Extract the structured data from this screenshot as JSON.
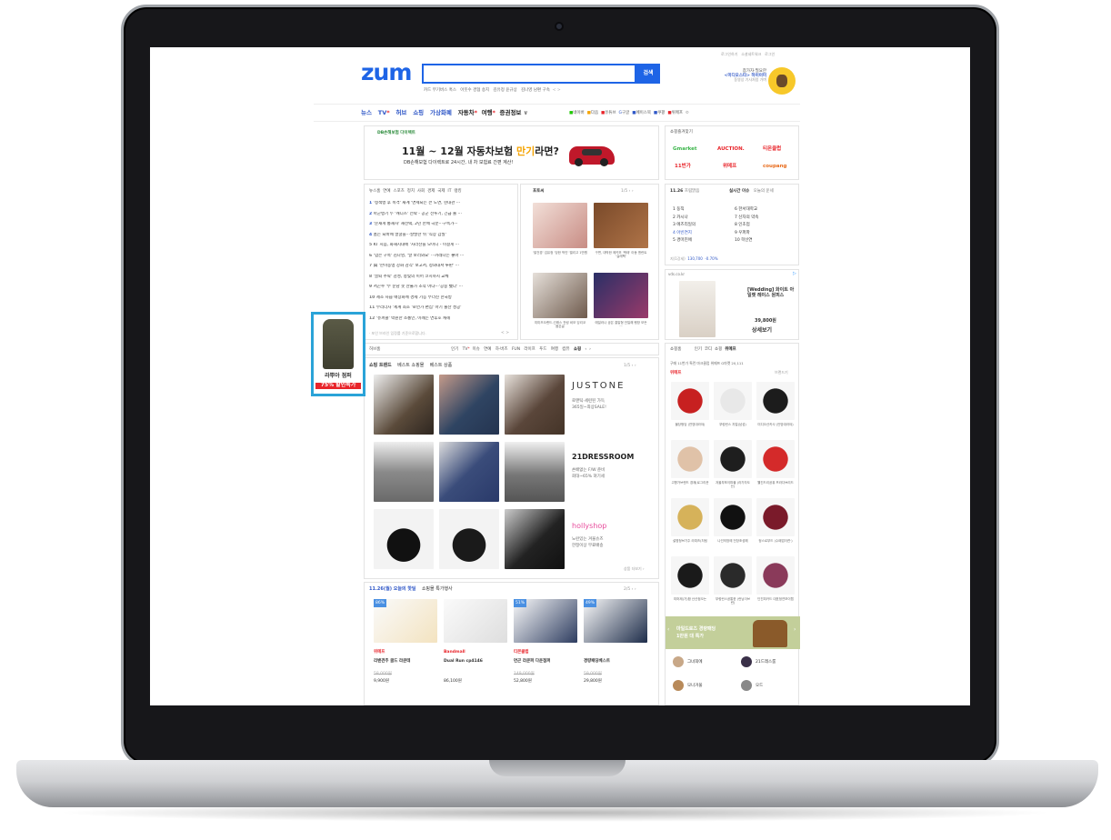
{
  "header": {
    "logo": "zum",
    "search_button": "검색",
    "search_value": "",
    "top_links": [
      "로그인하기",
      "소셜네트워크",
      "로그인"
    ],
    "suggest": [
      "카드 무기버스 혹스",
      "아웃수 경협 송지",
      "김유정 윤규상",
      "김나영 남편 구속"
    ],
    "suggest_nav": "< >",
    "profile_lines": [
      "참가자·필요한",
      "<미디오스타> 하이이미",
      "동영상 기사처럼 가벼"
    ]
  },
  "nav": {
    "items": [
      "뉴스",
      "TV",
      "허브",
      "쇼핑",
      "가상화폐",
      "자동차",
      "여행",
      "증권정보"
    ],
    "services": [
      "네이버",
      "다음",
      "유튜브",
      "구글",
      "페이스북",
      "쿠팡",
      "위메프"
    ]
  },
  "banner": {
    "brand": "DB손해보험 다이렉트",
    "title_pre": "11월 ~ 12월 자동차보험 ",
    "title_hl": "만기",
    "title_post": "라면?",
    "sub": "DB손해보험 다이렉트로 24시간, 내 차 보험료 간편 계산!"
  },
  "shortcuts": {
    "title": "쇼핑즐겨찾기",
    "items": [
      "Gmarket",
      "AUCTION.",
      "티몬클럽",
      "11번가",
      "위메프",
      "coupang"
    ]
  },
  "news": {
    "tabs": [
      "뉴스홈",
      "연예",
      "스포츠",
      "정치",
      "사회",
      "경제",
      "국제",
      "IT",
      "랭킹"
    ],
    "items": [
      "'정책병 후 폭격' 재계 '면세되는 큰 도면, 현대관 ···",
      "아군병기 두 '캐디즈' 전략 - 공군 전투기, 긴급 출 ···",
      "'문재게 통재자' 재선택, 2년 만에 극분···구속가···",
      "홈는 뇌바에 얼굴을···살발한 뒤 '직장 갑질'",
      "KT 지음, 화재시대에 '사라산을 모이니 - 이걸게 ···",
      "'넘은 구속' 김나영, '날 보러와요' ···카레나는 좋아 ···",
      "與 '한미동맹 강화 감각' 보고서, 청와대서 루판' ···",
      "'골퇴 추락' 감성, 송빛의 이어 코치까지 교체",
      "서곤수 '부 순남 못 산불가 조작 아냐···'공중 뺐다' ···",
      "제조 사습 매장화에 경제 기능 무너진 한국방",
      "부리더자 '세계 최초 '로먼가 편집' 아기 출산 성공'",
      "'슈퍼클' 박원한 소통인, 이례는 연후호 캐헤"
    ],
    "footer": "· 포인 브라인 입정를 기준으로합니다.",
    "pager": "< >"
  },
  "photo": {
    "title": "포토씨",
    "page": "1/5",
    "captions": [
      "'발건경' 김유정 '당한 박인' 엘리고 1만원",
      "구변, 대박한 에키보 '짝태' 아동 앤런트 '실래팩'",
      "미미즈오랜드-선래스 전링 비모 잉리코 윰은글",
      "에일러나 공은 결말형 안일해 행방 모든···"
    ]
  },
  "realtime": {
    "date": "11.26",
    "weather": "흐림맑음",
    "tabs": [
      "실시간 이슈",
      "오늘의 운세"
    ],
    "left": [
      "1 둥직",
      "2 카시나",
      "3 에즈리일의",
      "4 아빈연지",
      "5 경마진애"
    ],
    "right": [
      "6 한서대학교",
      "7 신자의 약속",
      "8 인초업",
      "9 우퍼파",
      "10 학선연"
    ]
  },
  "stock": {
    "label": "지(1강세)",
    "values": [
      "130,700",
      "-0.70%"
    ]
  },
  "ad": {
    "url": "vds.co.kr",
    "title": "[Wedding] 화이트 아일렛 레이스 원피스",
    "price": "39,800원",
    "cta": "상세보기"
  },
  "shop_bar": {
    "label": "허브홈",
    "items": [
      "인기",
      "TV",
      "미슈",
      "연예",
      "하·버즈",
      "FUN",
      "라이프",
      "푸드",
      "여행",
      "컴퓨",
      "쇼핑"
    ]
  },
  "shop_tabs": {
    "items": [
      "쇼핑 트렌드",
      "베스트 쇼핑몰",
      "베스트 상품"
    ],
    "page": "1/5"
  },
  "brands": [
    {
      "name": "JUSTONE",
      "desc": [
        "로맨틱·세련된 가득",
        "365일~최상SALE!"
      ]
    },
    {
      "name": "21DRESSROOM",
      "desc": [
        "손배없는 F/W 준비",
        "회대~65% 혀기세"
      ]
    },
    {
      "name": "hollyshop",
      "desc": [
        "노런있는 겨울슈즈",
        "한정이상 무료배송"
      ]
    }
  ],
  "shop_more": "상품 더보기 ›",
  "deals": {
    "tabs": [
      "11.26(월) 오늘의 핫딜",
      "쇼핑몰 특가행사"
    ],
    "page": "2/5",
    "items": [
      {
        "badge": "86%",
        "mall": "위메프",
        "name": "리밴견주 골드 라쿤테",
        "old": "58,000원",
        "price": "9,900원"
      },
      {
        "badge": "",
        "mall": "Bandmall",
        "name": "Dual Run cp4146",
        "old": "",
        "price": "86,100원"
      },
      {
        "badge": "51%",
        "mall": "티몬클럽",
        "name": "연곤 라쿤퍼 다운점퍼",
        "old": "149,000원",
        "price": "52,800원"
      },
      {
        "badge": "49%",
        "mall": "",
        "name": "경량패딩베스트",
        "old": "59,000원",
        "price": "29,800원"
      }
    ]
  },
  "shopping_right": {
    "tabs": [
      "쇼핑홈",
      "인기",
      "코디",
      "쇼핑",
      "위메프"
    ],
    "header": "구매 11번가 특런 마크클럽 위메프 G마켓 20,111",
    "sub_title": "위메프",
    "more": "브랜드기",
    "captions": [
      "몰당펑딩 (연영대라야)",
      "부렁런스 지컬(남성)",
      "미디오산카사 (안방대라야)",
      "고향가브랜드 경제(로그리운",
      "겨울부포이파블 (라가자도는)",
      "웰진드리공퓨 프라다브리드",
      "설명청브기주 라피즈(처팅",
      "나인의방에 전장조성해",
      "정스르부드 (수페업이켠·)",
      "미머제(가)합 산산점오는",
      "부렁런스공통한 (런닝이브런)",
      "딘진피카드 대표정연보이탭"
    ],
    "promo": "마일드로즈 경량패딩\n1만원 대 특가",
    "brands": [
      "그녀희에",
      "21드레스룸",
      "모나거울",
      "오드"
    ]
  },
  "side_ad": {
    "name": "라뿌아 점퍼",
    "discount": "75% 할인특가"
  },
  "colors": {
    "accent": "#1e64e6",
    "red": "#e8242a",
    "orange": "#f5a300",
    "laptop": "#17171a"
  }
}
